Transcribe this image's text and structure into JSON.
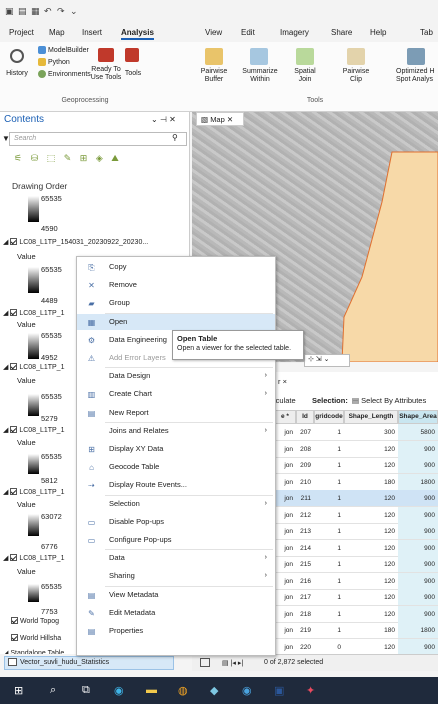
{
  "quick_access": {
    "icons": [
      "save-icon",
      "open-icon",
      "undo-icon",
      "redo-icon"
    ]
  },
  "menu": {
    "left_tabs": [
      "Project",
      "Map",
      "Insert",
      "Analysis"
    ],
    "right_tabs": [
      "View",
      "Edit",
      "Imagery",
      "Share",
      "Help",
      "Tab"
    ],
    "active": "Analysis"
  },
  "ribbon": {
    "history": "History",
    "modelbuilder": "ModelBuilder",
    "python": "Python",
    "environments": "Environments",
    "ready_to": "Ready To",
    "use_tools": "Use Tools",
    "tools": "Tools",
    "geoprocessing_group": "Geoprocessing",
    "tools_group": "Tools",
    "tool_labels": [
      "Pairwise\nBuffer",
      "Summarize\nWithin",
      "Spatial\nJoin",
      "Pairwise\nClip",
      "Optimized H\nSpot Analys"
    ]
  },
  "contents": {
    "title": "Contents",
    "search_placeholder": "Search",
    "drawing_order": "Drawing Order",
    "layer_name": "LC08_L1TP_154031_20230922_20230...",
    "layer_short": "LC08_L1TP_1",
    "value_label": "Value",
    "layers": [
      {
        "hi": "65535",
        "lo": "4590"
      },
      {
        "hi": "65535",
        "lo": "4489"
      },
      {
        "hi": "65535",
        "lo": "4952"
      },
      {
        "hi": "65535",
        "lo": "5279"
      },
      {
        "hi": "65535",
        "lo": "5812"
      },
      {
        "hi": "63072",
        "lo": "6776"
      },
      {
        "hi": "65535",
        "lo": "7753"
      }
    ],
    "basemaps": [
      "World Topog",
      "World Hillsha"
    ],
    "standalone": "Standalone Table",
    "selected_table": "Vector_suvli_hudu_Statistics"
  },
  "map": {
    "tab_label": "Map"
  },
  "context_menu": {
    "items": [
      {
        "label": "Copy",
        "icon": "copy-icon"
      },
      {
        "label": "Remove",
        "icon": "remove-icon"
      },
      {
        "label": "Group",
        "icon": "group-icon"
      },
      {
        "label": "Open",
        "icon": "table-icon",
        "highlighted": true
      },
      {
        "label": "Data Engineering",
        "icon": "data-engineering-icon"
      },
      {
        "label": "Add Error Layers",
        "icon": "error-layers-icon",
        "disabled": true
      },
      {
        "label": "Data Design",
        "submenu": true
      },
      {
        "label": "Create Chart",
        "icon": "chart-icon",
        "submenu": true
      },
      {
        "label": "New Report",
        "icon": "report-icon"
      },
      {
        "label": "Joins and Relates",
        "submenu": true
      },
      {
        "label": "Display XY Data",
        "icon": "xy-data-icon"
      },
      {
        "label": "Geocode Table",
        "icon": "geocode-icon"
      },
      {
        "label": "Display Route Events...",
        "icon": "route-icon"
      },
      {
        "label": "Selection",
        "submenu": true
      },
      {
        "label": "Disable Pop-ups",
        "icon": "popup-icon"
      },
      {
        "label": "Configure Pop-ups",
        "icon": "configure-popup-icon"
      },
      {
        "label": "Data",
        "submenu": true
      },
      {
        "label": "Sharing",
        "submenu": true
      },
      {
        "label": "View Metadata",
        "icon": "metadata-icon"
      },
      {
        "label": "Edit Metadata",
        "icon": "edit-metadata-icon"
      },
      {
        "label": "Properties",
        "icon": "properties-icon"
      }
    ]
  },
  "tooltip": {
    "title": "Open Table",
    "text": "Open a viewer for the selected table."
  },
  "table": {
    "tab": "r ×",
    "calculate": "lculate",
    "selection_label": "Selection:",
    "select_by_attributes": "Select By Attributes",
    "columns": [
      "e *",
      "Id",
      "gridcode",
      "Shape_Length",
      "Shape_Area"
    ],
    "rows": [
      [
        "jon",
        "207",
        "1",
        "300",
        "5800"
      ],
      [
        "jon",
        "208",
        "1",
        "120",
        "900"
      ],
      [
        "jon",
        "209",
        "1",
        "120",
        "900"
      ],
      [
        "jon",
        "210",
        "1",
        "180",
        "1800"
      ],
      [
        "jon",
        "211",
        "1",
        "120",
        "900"
      ],
      [
        "jon",
        "212",
        "1",
        "120",
        "900"
      ],
      [
        "jon",
        "213",
        "1",
        "120",
        "900"
      ],
      [
        "jon",
        "214",
        "1",
        "120",
        "900"
      ],
      [
        "jon",
        "215",
        "1",
        "120",
        "900"
      ],
      [
        "jon",
        "216",
        "1",
        "120",
        "900"
      ],
      [
        "jon",
        "217",
        "1",
        "120",
        "900"
      ],
      [
        "jon",
        "218",
        "1",
        "120",
        "900"
      ],
      [
        "jon",
        "219",
        "1",
        "180",
        "1800"
      ],
      [
        "jon",
        "220",
        "0",
        "120",
        "900"
      ]
    ],
    "status": "0 of 2,872 selected"
  },
  "colors": {
    "accent": "#1a5fb4",
    "highlight": "#d7e8f7",
    "polygon_fill": "#f7d9a8",
    "polygon_stroke": "#e07030",
    "taskbar": "#1f2a3c"
  }
}
